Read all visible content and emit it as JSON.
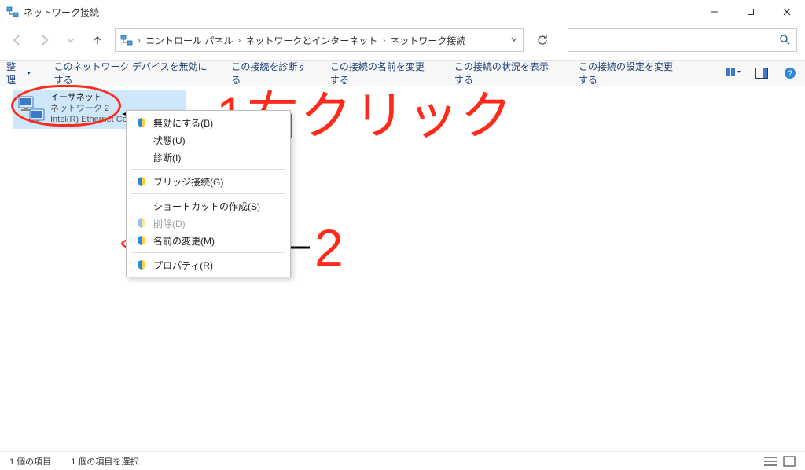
{
  "window": {
    "title": "ネットワーク接続"
  },
  "breadcrumbs": {
    "root": "コントロール パネル",
    "mid": "ネットワークとインターネット",
    "leaf": "ネットワーク接続",
    "sep": "›"
  },
  "search": {
    "placeholder": ""
  },
  "cmdbar": {
    "organize": "整理",
    "disable": "このネットワーク デバイスを無効にする",
    "diagnose": "この接続を診断する",
    "rename": "この接続の名前を変更する",
    "status": "この接続の状況を表示する",
    "settings": "この接続の設定を変更する"
  },
  "connection": {
    "name": "イーサネット",
    "network": "ネットワーク 2",
    "device": "Intel(R) Ethernet Co..."
  },
  "ctx": {
    "disable": "無効にする(B)",
    "status": "状態(U)",
    "diagnose": "診断(I)",
    "bridge": "ブリッジ接続(G)",
    "shortcut": "ショートカットの作成(S)",
    "delete": "削除(D)",
    "rename": "名前の変更(M)",
    "properties": "プロパティ(R)"
  },
  "annotations": {
    "anno1": "1右クリック",
    "anno2": "2"
  },
  "statusbar": {
    "count": "1 個の項目",
    "selected": "1 個の項目を選択"
  }
}
